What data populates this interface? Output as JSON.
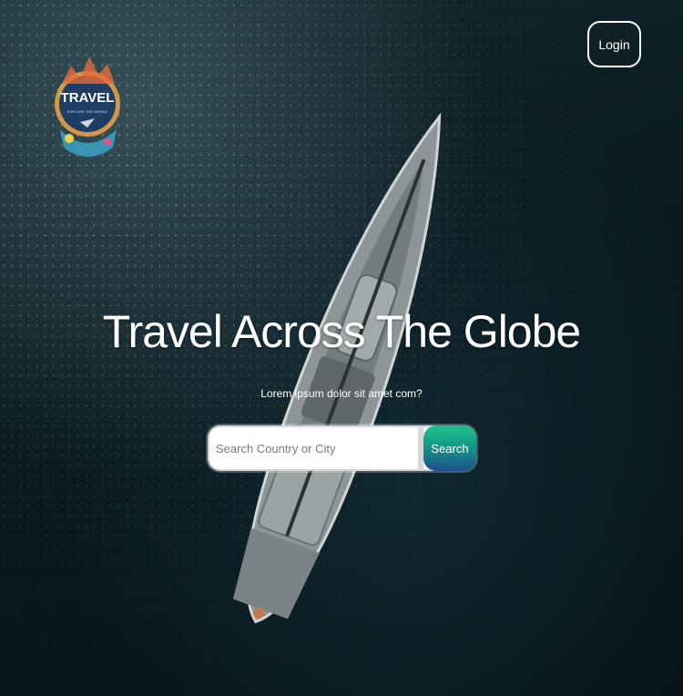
{
  "brand": {
    "logo_text": "TRAVEL",
    "logo_tagline": "EXPLORE THE WORLD"
  },
  "header": {
    "login_label": "Login"
  },
  "hero": {
    "title": "Travel Across The Globe",
    "subtitle": "Lorem ipsum dolor sit amet com?"
  },
  "search": {
    "placeholder": "Search Country or City",
    "value": "",
    "button_label": "Search"
  },
  "colors": {
    "text": "#ffffff",
    "search_button_top": "#1fc28a",
    "search_button_bottom": "#1e4f8e",
    "background_dark": "#0b1b20"
  },
  "icons": {
    "logo": "travel-globe-logo-icon"
  }
}
